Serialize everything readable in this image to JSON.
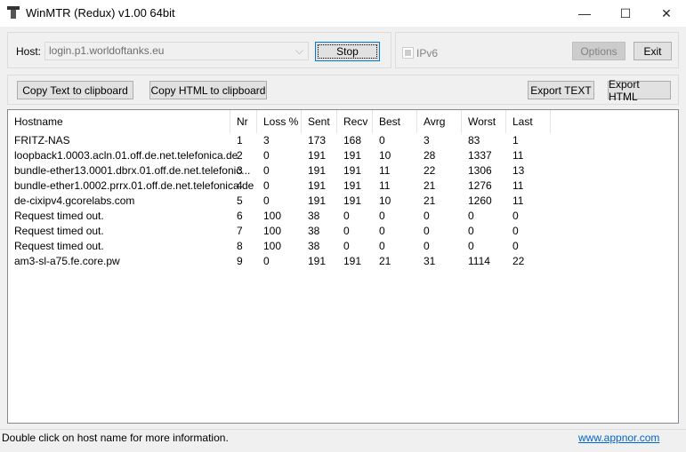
{
  "window": {
    "title": "WinMTR (Redux) v1.00 64bit",
    "minimize": "—",
    "maximize": "☐",
    "close": "✕"
  },
  "host": {
    "label": "Host:",
    "value": "login.p1.worldoftanks.eu"
  },
  "buttons": {
    "stop": "Stop",
    "ipv6": "IPv6",
    "options": "Options",
    "exit": "Exit",
    "copy_text": "Copy Text to clipboard",
    "copy_html": "Copy HTML to clipboard",
    "export_text": "Export TEXT",
    "export_html": "Export HTML"
  },
  "table": {
    "columns": [
      "Hostname",
      "Nr",
      "Loss %",
      "Sent",
      "Recv",
      "Best",
      "Avrg",
      "Worst",
      "Last"
    ],
    "rows": [
      [
        "FRITZ-NAS",
        "1",
        "3",
        "173",
        "168",
        "0",
        "3",
        "83",
        "1"
      ],
      [
        "loopback1.0003.acln.01.off.de.net.telefonica.de",
        "2",
        "0",
        "191",
        "191",
        "10",
        "28",
        "1337",
        "11"
      ],
      [
        "bundle-ether13.0001.dbrx.01.off.de.net.telefonic...",
        "3",
        "0",
        "191",
        "191",
        "11",
        "22",
        "1306",
        "13"
      ],
      [
        "bundle-ether1.0002.prrx.01.off.de.net.telefonica.de",
        "4",
        "0",
        "191",
        "191",
        "11",
        "21",
        "1276",
        "11"
      ],
      [
        "de-cixipv4.gcorelabs.com",
        "5",
        "0",
        "191",
        "191",
        "10",
        "21",
        "1260",
        "11"
      ],
      [
        "Request timed out.",
        "6",
        "100",
        "38",
        "0",
        "0",
        "0",
        "0",
        "0"
      ],
      [
        "Request timed out.",
        "7",
        "100",
        "38",
        "0",
        "0",
        "0",
        "0",
        "0"
      ],
      [
        "Request timed out.",
        "8",
        "100",
        "38",
        "0",
        "0",
        "0",
        "0",
        "0"
      ],
      [
        "am3-sl-a75.fe.core.pw",
        "9",
        "0",
        "191",
        "191",
        "21",
        "31",
        "1114",
        "22"
      ]
    ]
  },
  "status": {
    "text": "Double click on host name for more information.",
    "link": "www.appnor.com"
  },
  "colors": {
    "link": "#0066cc",
    "focus": "#0078d7"
  }
}
